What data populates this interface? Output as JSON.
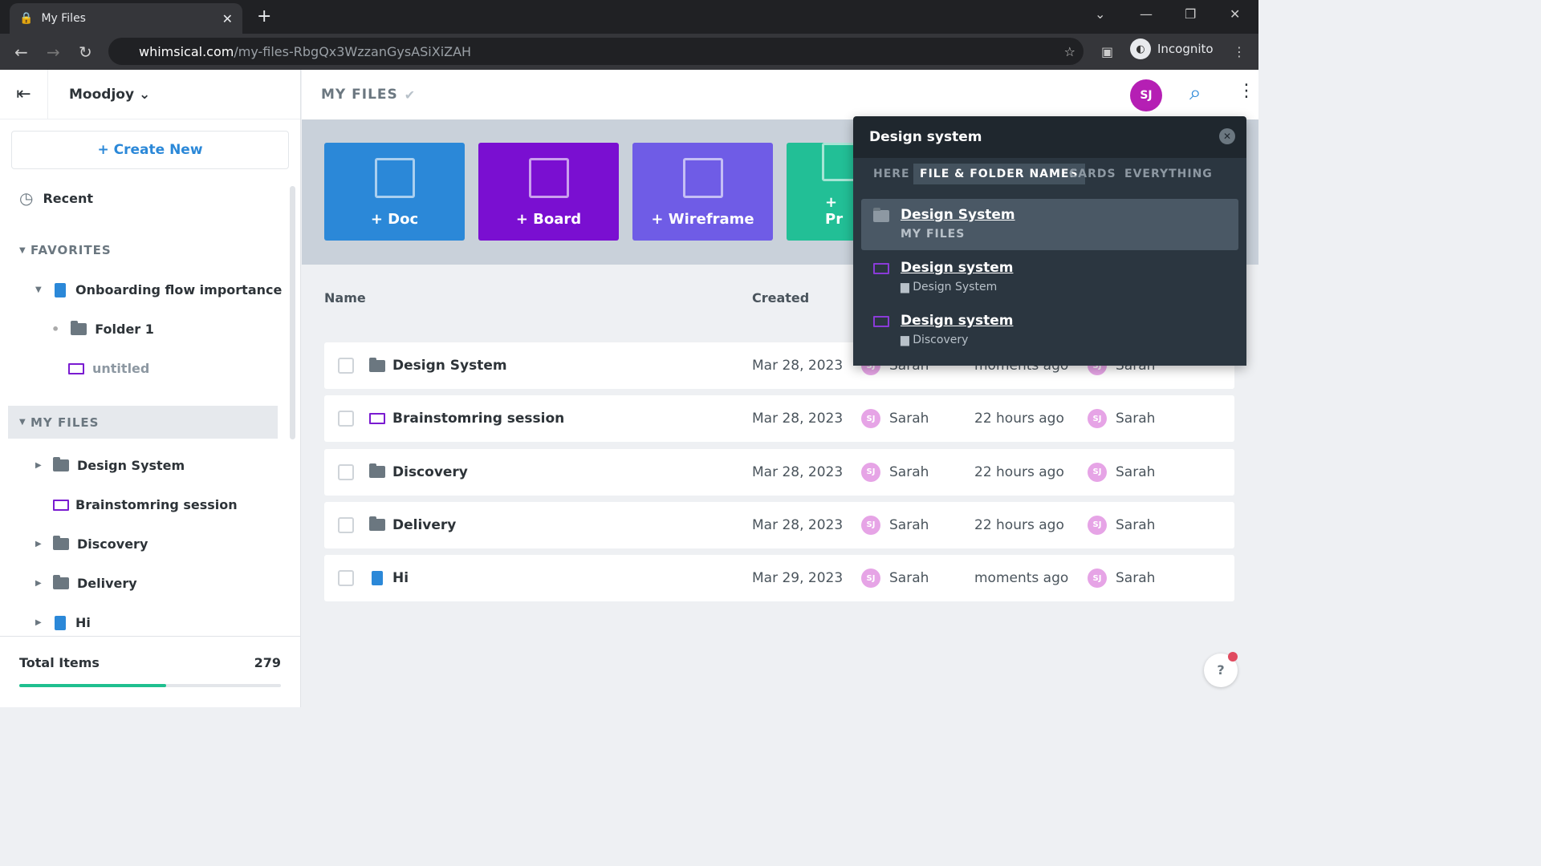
{
  "browser": {
    "tab_title": "My Files",
    "url_host": "whimsical.com",
    "url_path": "/my-files-RbgQx3WzzanGysASiXiZAH",
    "profile": "Incognito"
  },
  "sidebar": {
    "workspace": "Moodjoy",
    "create_new": "+ Create New",
    "recent": "Recent",
    "favorites_label": "FAVORITES",
    "favorites": [
      {
        "label": "Onboarding flow importance",
        "icon": "doc-icon"
      },
      {
        "label": "Folder 1",
        "icon": "folder-icon"
      },
      {
        "label": "untitled",
        "icon": "board-icon"
      }
    ],
    "my_files_label": "MY FILES",
    "my_files": [
      {
        "label": "Design System",
        "icon": "folder-icon"
      },
      {
        "label": "Brainstomring session",
        "icon": "board-icon"
      },
      {
        "label": "Discovery",
        "icon": "folder-icon"
      },
      {
        "label": "Delivery",
        "icon": "folder-icon"
      },
      {
        "label": "Hi",
        "icon": "doc-icon"
      }
    ],
    "total_label": "Total Items",
    "total_value": "279",
    "usage_fraction": 0.56
  },
  "header": {
    "title": "MY FILES",
    "avatar": "SJ"
  },
  "tiles": [
    {
      "label": "+ Doc",
      "color": "#2b88d8"
    },
    {
      "label": "+ Board",
      "color": "#7a0fd1"
    },
    {
      "label": "+ Wireframe",
      "color": "#6f5ce6"
    },
    {
      "label": "+ Pr",
      "color": "#22bf96"
    }
  ],
  "table": {
    "columns": [
      "Name",
      "Created"
    ],
    "rows": [
      {
        "name": "Design System",
        "icon": "folder",
        "created": "Mar 28, 2023",
        "created_by": "Sarah",
        "modified": "moments ago",
        "modified_by": "Sarah"
      },
      {
        "name": "Brainstomring session",
        "icon": "board",
        "created": "Mar 28, 2023",
        "created_by": "Sarah",
        "modified": "22 hours ago",
        "modified_by": "Sarah"
      },
      {
        "name": "Discovery",
        "icon": "folder",
        "created": "Mar 28, 2023",
        "created_by": "Sarah",
        "modified": "22 hours ago",
        "modified_by": "Sarah"
      },
      {
        "name": "Delivery",
        "icon": "folder",
        "created": "Mar 28, 2023",
        "created_by": "Sarah",
        "modified": "22 hours ago",
        "modified_by": "Sarah"
      },
      {
        "name": "Hi",
        "icon": "doc",
        "created": "Mar 29, 2023",
        "created_by": "Sarah",
        "modified": "moments ago",
        "modified_by": "Sarah"
      }
    ],
    "avatar_initials": "SJ"
  },
  "search_popup": {
    "query": "Design system",
    "tabs": [
      "HERE",
      "FILE & FOLDER NAMES",
      "CARDS",
      "EVERYTHING"
    ],
    "active_tab": "FILE & FOLDER NAMES",
    "results": [
      {
        "name": "Design System",
        "sub": "MY FILES",
        "icon": "folder"
      },
      {
        "name": "Design system",
        "sub": "Design System",
        "icon": "board"
      },
      {
        "name": "Design system",
        "sub": "Discovery",
        "icon": "board"
      }
    ]
  },
  "help": "?"
}
